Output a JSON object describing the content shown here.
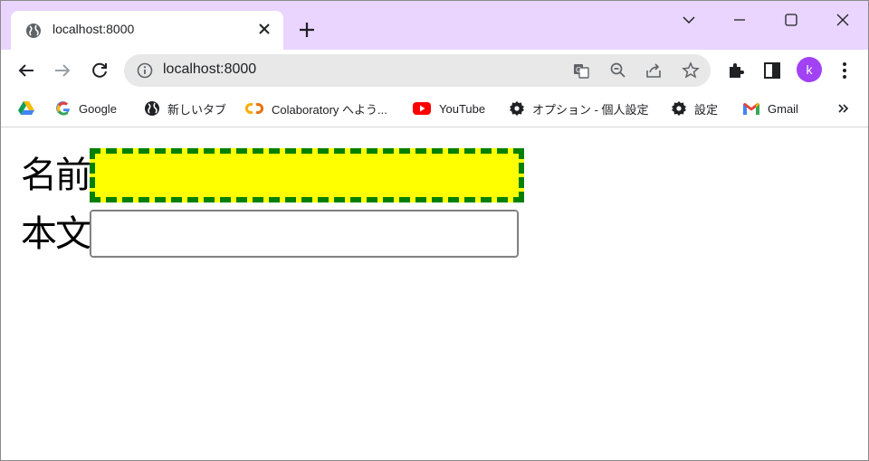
{
  "browser": {
    "tab": {
      "title": "localhost:8000",
      "favicon": "globe-icon"
    },
    "address_bar": {
      "url": "localhost:8000"
    },
    "profile_initial": "k",
    "colors": {
      "titlebar": "#e9d5ff",
      "avatar": "#a142f4"
    }
  },
  "bookmarks": [
    {
      "label": "",
      "icon": "google-drive-icon"
    },
    {
      "label": "Google",
      "icon": "google-icon"
    },
    {
      "label": "新しいタブ",
      "icon": "globe-icon"
    },
    {
      "label": "Colaboratory へよう...",
      "icon": "colab-icon"
    },
    {
      "label": "YouTube",
      "icon": "youtube-icon"
    },
    {
      "label": "オプション - 個人設定",
      "icon": "gear-icon"
    },
    {
      "label": "設定",
      "icon": "gear-icon"
    },
    {
      "label": "Gmail",
      "icon": "gmail-icon"
    }
  ],
  "form": {
    "name_label": "名前",
    "body_label": "本文",
    "name_value": "",
    "body_value": "",
    "colors": {
      "name_bg": "#ffff00",
      "name_border": "#008000"
    }
  }
}
